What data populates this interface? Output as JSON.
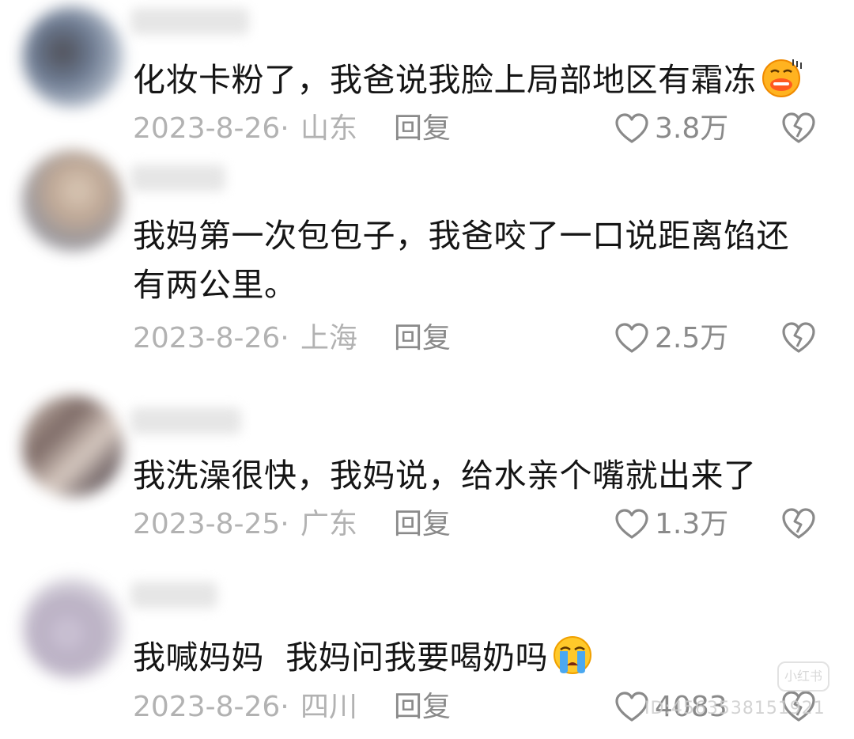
{
  "comments": [
    {
      "text": "化妆卡粉了，我爸说我脸上局部地区有霜冻",
      "emoji": "cold-face-emoji",
      "date": "2023-8-26·",
      "location": "山东",
      "reply_label": "回复",
      "likes": "3.8万"
    },
    {
      "text_line1": "我妈第一次包包子，我爸咬了一口说距离馅还",
      "text_line2": "有两公里。",
      "date": "2023-8-26·",
      "location": "上海",
      "reply_label": "回复",
      "likes": "2.5万"
    },
    {
      "text": "我洗澡很快，我妈说，给水亲个嘴就出来了",
      "date": "2023-8-25·",
      "location": "广东",
      "reply_label": "回复",
      "likes": "1.3万"
    },
    {
      "text": "我喊妈妈  我妈问我要喝奶吗",
      "emoji": "crying-face-emoji",
      "date": "2023-8-26·",
      "location": "四川",
      "reply_label": "回复",
      "likes": "4083"
    }
  ],
  "watermark": {
    "logo_text": "小红书",
    "id_text": "ID:4563538151921"
  },
  "colors": {
    "text": "#151515",
    "meta": "#b2b2b2",
    "icon": "#8a8a8a",
    "background": "#ffffff"
  }
}
